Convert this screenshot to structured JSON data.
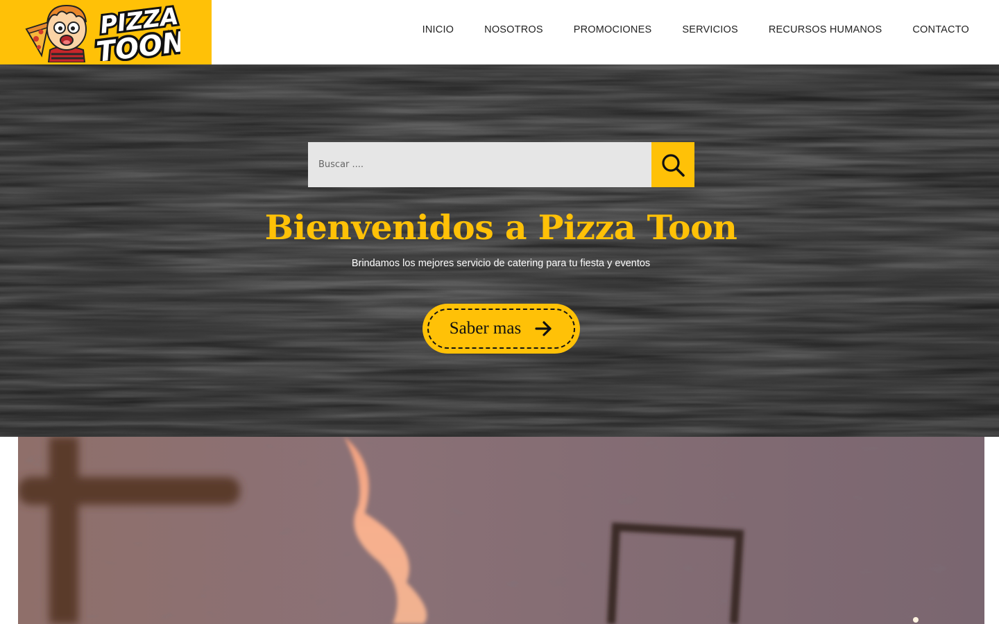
{
  "brand": {
    "name_line1": "PIZZA",
    "name_line2": "TOON",
    "accent_color": "#FFC107"
  },
  "nav": {
    "items": [
      {
        "label": "INICIO"
      },
      {
        "label": "NOSOTROS"
      },
      {
        "label": "PROMOCIONES"
      },
      {
        "label": "SERVICIOS"
      },
      {
        "label": "RECURSOS HUMANOS"
      },
      {
        "label": "CONTACTO"
      }
    ]
  },
  "search": {
    "placeholder": "Buscar ....",
    "value": "",
    "icon": "search-icon"
  },
  "hero": {
    "title": "Bienvenidos a Pizza Toon",
    "subtitle": "Brindamos los mejores servicio de catering para tu fiesta y eventos",
    "cta_label": "Saber mas",
    "cta_icon": "arrow-right-icon",
    "background": "dark-wood-texture"
  },
  "media": {
    "description_icon": "fire-oven-video"
  }
}
